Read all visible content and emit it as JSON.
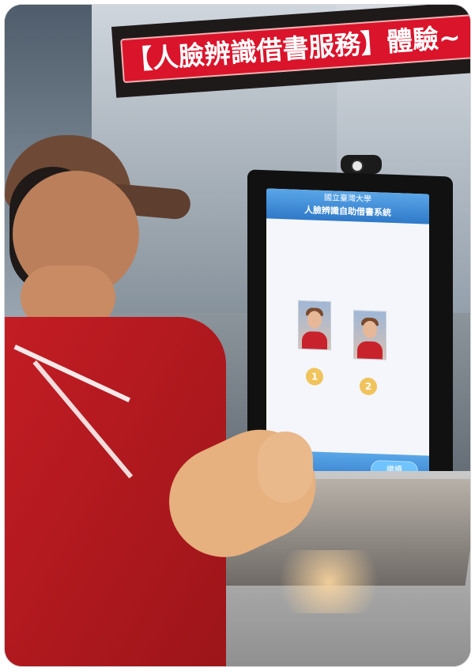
{
  "banner": {
    "text": "【人臉辨識借書服務】體驗~"
  },
  "kiosk": {
    "header_univ": "國立臺灣大學",
    "header_title": "人臉辨識自助借書系統",
    "steps": [
      "1",
      "2"
    ],
    "footer_button": "繼續"
  },
  "colors": {
    "banner_red": "#d9142b",
    "kiosk_blue": "#2f79c8",
    "shirt_red": "#c31d24",
    "cap_brown": "#6e4a36",
    "step_gold": "#f0c35c"
  }
}
